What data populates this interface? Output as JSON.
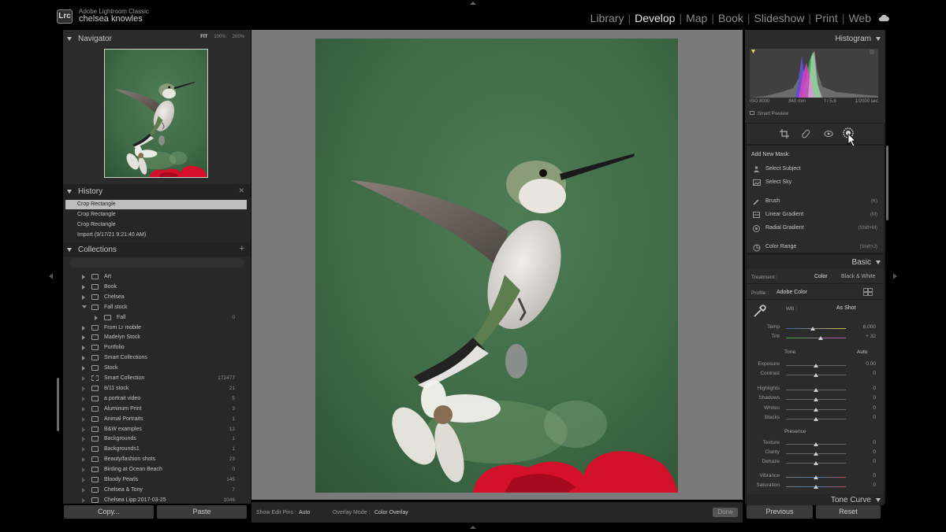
{
  "app": {
    "product": "Adobe Lightroom Classic",
    "user": "chelsea knowles",
    "logo_text": "Lrc"
  },
  "modules": [
    "Library",
    "Develop",
    "Map",
    "Book",
    "Slideshow",
    "Print",
    "Web"
  ],
  "active_module": "Develop",
  "navigator": {
    "title": "Navigator",
    "zoom": [
      "FIT",
      "100%",
      "200%"
    ]
  },
  "history": {
    "title": "History",
    "items": [
      "Crop Rectangle",
      "Crop Rectangle",
      "Crop Rectangle",
      "Import (9/17/21 9:21:40 AM)"
    ],
    "selected_index": 0
  },
  "collections": {
    "title": "Collections",
    "items": [
      {
        "name": "Art",
        "count": "",
        "level": 0,
        "state": "collapsed",
        "type": "set"
      },
      {
        "name": "Book",
        "count": "",
        "level": 0,
        "state": "collapsed",
        "type": "set"
      },
      {
        "name": "Chelsea",
        "count": "",
        "level": 0,
        "state": "collapsed",
        "type": "set"
      },
      {
        "name": "Fall stock",
        "count": "",
        "level": 0,
        "state": "expanded",
        "type": "set"
      },
      {
        "name": "Fall",
        "count": "0",
        "level": 1,
        "state": "collapsed",
        "type": "collection"
      },
      {
        "name": "From Lr mobile",
        "count": "",
        "level": 0,
        "state": "collapsed",
        "type": "set"
      },
      {
        "name": "Madelyn Stock",
        "count": "",
        "level": 0,
        "state": "collapsed",
        "type": "set"
      },
      {
        "name": "Portfolio",
        "count": "",
        "level": 0,
        "state": "collapsed",
        "type": "set"
      },
      {
        "name": "Smart Collections",
        "count": "",
        "level": 0,
        "state": "collapsed",
        "type": "set"
      },
      {
        "name": "Stock",
        "count": "",
        "level": 0,
        "state": "collapsed",
        "type": "set"
      },
      {
        "name": "Smart Collection",
        "count": "172477",
        "level": 0,
        "state": "leaf",
        "type": "smart"
      },
      {
        "name": "8/11 stock",
        "count": "21",
        "level": 0,
        "state": "leaf",
        "type": "collection"
      },
      {
        "name": "a portrait video",
        "count": "5",
        "level": 0,
        "state": "leaf",
        "type": "collection"
      },
      {
        "name": "Aluminum Print",
        "count": "3",
        "level": 0,
        "state": "leaf",
        "type": "collection"
      },
      {
        "name": "Animal Portraits",
        "count": "1",
        "level": 0,
        "state": "leaf",
        "type": "collection"
      },
      {
        "name": "B&W examples",
        "count": "12",
        "level": 0,
        "state": "leaf",
        "type": "collection"
      },
      {
        "name": "Backgrounds",
        "count": "1",
        "level": 0,
        "state": "leaf",
        "type": "collection"
      },
      {
        "name": "Backgrounds1",
        "count": "1",
        "level": 0,
        "state": "leaf",
        "type": "collection"
      },
      {
        "name": "Beauty/fashion shots",
        "count": "23",
        "level": 0,
        "state": "leaf",
        "type": "collection"
      },
      {
        "name": "Birding at Ocean Beach",
        "count": "0",
        "level": 0,
        "state": "leaf",
        "type": "collection"
      },
      {
        "name": "Bloody Pearls",
        "count": "145",
        "level": 0,
        "state": "leaf",
        "type": "collection"
      },
      {
        "name": "Chelsea & Tony",
        "count": "7",
        "level": 0,
        "state": "leaf",
        "type": "collection"
      },
      {
        "name": "Chelsea Lipp 2017-03-25",
        "count": "1046",
        "level": 0,
        "state": "leaf",
        "type": "collection"
      }
    ]
  },
  "left_buttons": {
    "copy": "Copy...",
    "paste": "Paste"
  },
  "toolbar": {
    "show_edit_pins_label": "Show Edit Pins :",
    "show_edit_pins_value": "Auto",
    "overlay_mode_label": "Overlay Mode :",
    "overlay_mode_value": "Color Overlay",
    "done": "Done"
  },
  "histogram": {
    "title": "Histogram",
    "iso": "ISO 8000",
    "focal": "840 mm",
    "aperture": "f / 5.6",
    "shutter": "1/2000 sec",
    "smart_preview": "Smart Preview"
  },
  "masks": {
    "title": "Add New Mask:",
    "items": [
      {
        "name": "Select Subject",
        "shortcut": "",
        "icon": "person-icon"
      },
      {
        "name": "Select Sky",
        "shortcut": "",
        "icon": "sky-icon"
      },
      {
        "name": "Brush",
        "shortcut": "(K)",
        "icon": "brush-icon"
      },
      {
        "name": "Linear Gradient",
        "shortcut": "(M)",
        "icon": "linear-gradient-icon"
      },
      {
        "name": "Radial Gradient",
        "shortcut": "(Shift+M)",
        "icon": "radial-gradient-icon"
      },
      {
        "name": "Color Range",
        "shortcut": "(Shift+J)",
        "icon": "color-range-icon"
      }
    ]
  },
  "basic": {
    "title": "Basic",
    "treatment_label": "Treatment :",
    "treatment_color": "Color",
    "treatment_bw": "Black & White",
    "profile_label": "Profile :",
    "profile_value": "Adobe Color",
    "wb_label": "WB :",
    "wb_value": "As Shot",
    "tone_label": "Tone",
    "tone_auto": "Auto",
    "presence_label": "Presence",
    "sliders": [
      {
        "name": "Temp",
        "value": "6,000",
        "pos": 0.45,
        "group": "wb"
      },
      {
        "name": "Tint",
        "value": "+ 32",
        "pos": 0.58,
        "group": "wb"
      },
      {
        "name": "Exposure",
        "value": "0.00",
        "pos": 0.5,
        "group": "tone"
      },
      {
        "name": "Contrast",
        "value": "0",
        "pos": 0.5,
        "group": "tone"
      },
      {
        "name": "Highlights",
        "value": "0",
        "pos": 0.5,
        "group": "tone2"
      },
      {
        "name": "Shadows",
        "value": "0",
        "pos": 0.5,
        "group": "tone2"
      },
      {
        "name": "Whites",
        "value": "0",
        "pos": 0.5,
        "group": "tone2"
      },
      {
        "name": "Blacks",
        "value": "0",
        "pos": 0.5,
        "group": "tone2"
      },
      {
        "name": "Texture",
        "value": "0",
        "pos": 0.5,
        "group": "presence"
      },
      {
        "name": "Clarity",
        "value": "0",
        "pos": 0.5,
        "group": "presence"
      },
      {
        "name": "Dehaze",
        "value": "0",
        "pos": 0.5,
        "group": "presence"
      },
      {
        "name": "Vibrance",
        "value": "0",
        "pos": 0.5,
        "group": "presence2"
      },
      {
        "name": "Saturation",
        "value": "0",
        "pos": 0.5,
        "group": "presence2"
      }
    ],
    "next_panel": "Tone Curve"
  },
  "right_buttons": {
    "previous": "Previous",
    "reset": "Reset"
  },
  "colors": {
    "photo_bg": "#3f6f46",
    "flower_red": "#d4102a",
    "panel": "#2b2b2b"
  }
}
